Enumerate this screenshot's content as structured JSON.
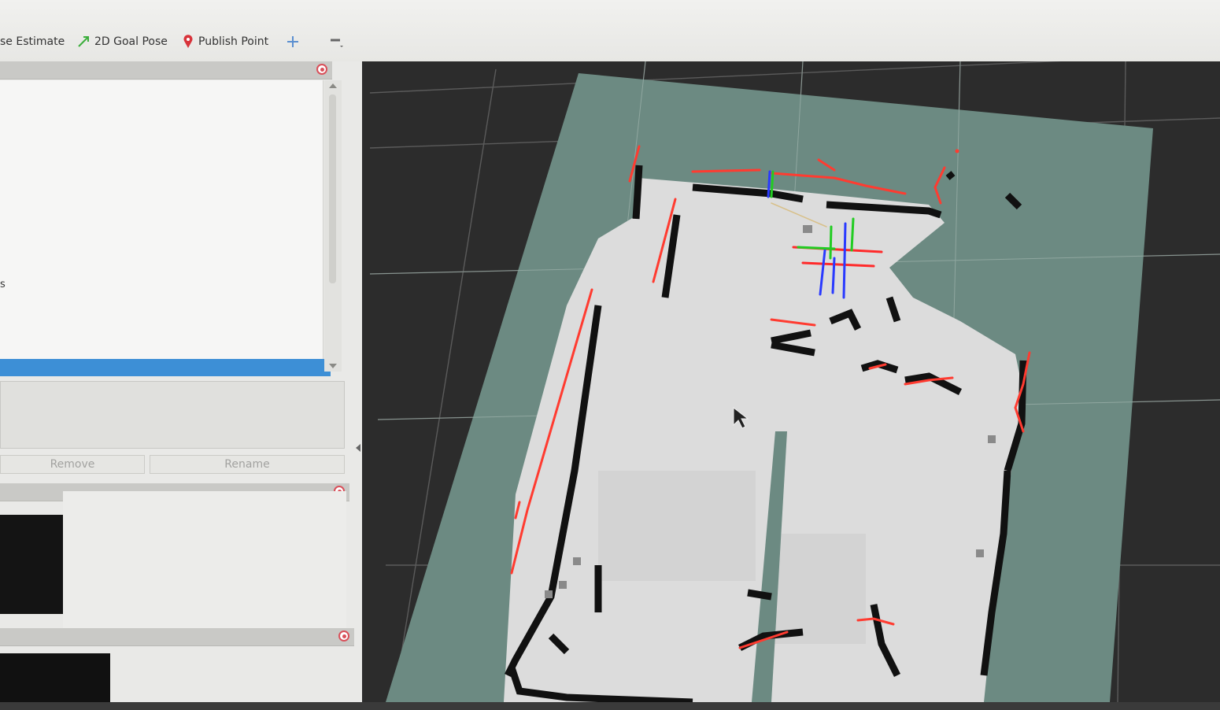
{
  "toolbar": {
    "pose_estimate_label": "se Estimate",
    "goal_pose_label": "2D Goal Pose",
    "publish_point_label": "Publish Point"
  },
  "left_panel": {
    "tree_partial_label": "s",
    "remove_label": "Remove",
    "rename_label": "Rename"
  },
  "colors": {
    "map_free": "#dcdcdc",
    "map_unknown": "#6c8a82",
    "map_occupied": "#101010",
    "laser_scan": "#ff3b30",
    "selection": "#3d8fd6"
  }
}
